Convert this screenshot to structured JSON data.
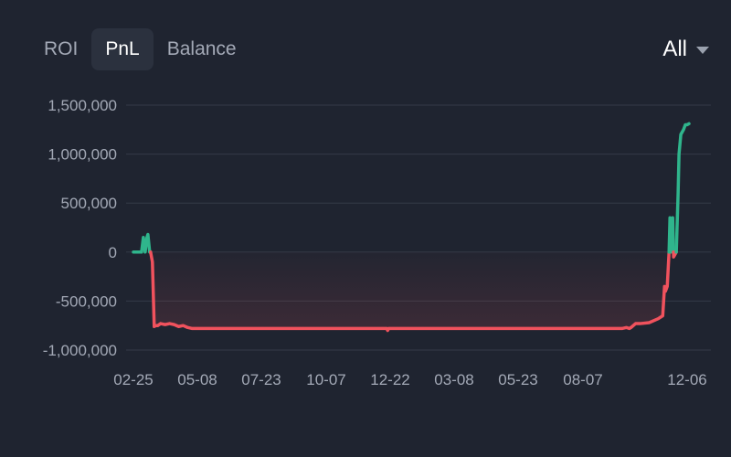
{
  "tabs": [
    {
      "label": "ROI",
      "active": false
    },
    {
      "label": "PnL",
      "active": true
    },
    {
      "label": "Balance",
      "active": false
    }
  ],
  "range": {
    "label": "All",
    "icon": "caret-down-icon"
  },
  "colors": {
    "background": "#1f2430",
    "gain": "#2fb58c",
    "loss": "#f0525d",
    "grid": "#343a47",
    "tick_text": "#a3a9b6"
  },
  "chart_data": {
    "type": "area",
    "title": "",
    "xlabel": "",
    "ylabel": "",
    "ylim": [
      -1000000,
      1500000
    ],
    "yticks": [
      1500000,
      1000000,
      500000,
      0,
      -500000,
      -1000000
    ],
    "ytick_labels": [
      "1,500,000",
      "1,000,000",
      "500,000",
      "0",
      "-500,000",
      "-1,000,000"
    ],
    "xtick_labels": [
      "02-25",
      "05-08",
      "07-23",
      "10-07",
      "12-22",
      "03-08",
      "05-23",
      "08-07",
      "12-06"
    ],
    "grid": true,
    "series": [
      {
        "x": [
          0,
          3,
          6,
          9,
          11,
          13,
          15,
          16,
          18,
          19,
          21,
          23,
          25,
          27,
          30,
          35,
          40,
          45,
          50,
          55,
          60,
          65,
          75,
          100,
          150,
          200,
          250,
          270,
          280,
          281,
          282,
          300,
          350,
          400,
          450,
          500,
          540,
          545,
          548,
          550,
          555,
          560,
          570,
          580,
          585,
          587,
          588,
          590,
          592,
          593,
          594,
          596,
          597,
          600,
          602,
          603,
          605,
          608,
          610,
          612,
          614
        ],
        "values": [
          0,
          0,
          0,
          0,
          150000,
          0,
          150000,
          180000,
          0,
          0,
          -100000,
          -760000,
          -750000,
          -750000,
          -730000,
          -740000,
          -730000,
          -740000,
          -760000,
          -750000,
          -770000,
          -780000,
          -780000,
          -780000,
          -780000,
          -780000,
          -780000,
          -780000,
          -780000,
          -800000,
          -780000,
          -780000,
          -780000,
          -780000,
          -780000,
          -780000,
          -780000,
          -770000,
          -780000,
          -770000,
          -730000,
          -730000,
          -720000,
          -680000,
          -650000,
          -350000,
          -400000,
          -350000,
          0,
          350000,
          0,
          350000,
          -50000,
          0,
          600000,
          1000000,
          1200000,
          1250000,
          1300000,
          1300000,
          1310000
        ]
      }
    ]
  }
}
